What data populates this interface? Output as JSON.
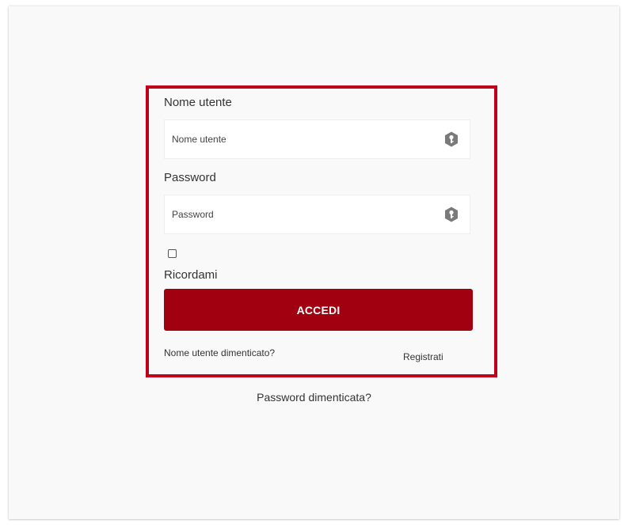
{
  "login": {
    "username_label": "Nome utente",
    "username_placeholder": "Nome utente",
    "password_label": "Password",
    "password_placeholder": "Password",
    "remember_label": "Ricordami",
    "submit_label": "ACCEDI",
    "forgot_username": "Nome utente dimenticato?",
    "register": "Registrati",
    "forgot_password": "Password dimenticata?"
  },
  "colors": {
    "highlight": "#c0001a",
    "button": "#a10010",
    "icon": "#7a7a7a"
  },
  "icons": {
    "field_icon": "key-icon"
  }
}
